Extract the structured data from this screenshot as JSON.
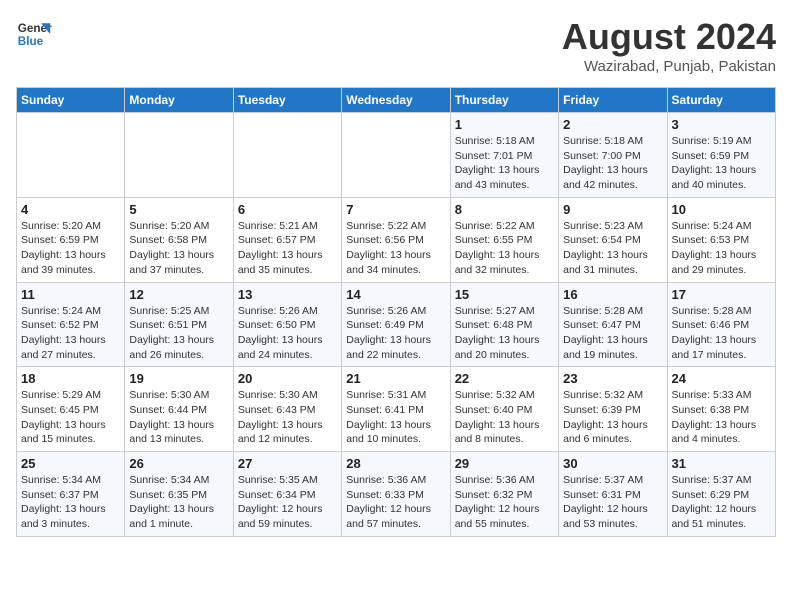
{
  "header": {
    "logo_line1": "General",
    "logo_line2": "Blue",
    "month_year": "August 2024",
    "location": "Wazirabad, Punjab, Pakistan"
  },
  "days_of_week": [
    "Sunday",
    "Monday",
    "Tuesday",
    "Wednesday",
    "Thursday",
    "Friday",
    "Saturday"
  ],
  "weeks": [
    [
      {
        "day": "",
        "info": ""
      },
      {
        "day": "",
        "info": ""
      },
      {
        "day": "",
        "info": ""
      },
      {
        "day": "",
        "info": ""
      },
      {
        "day": "1",
        "info": "Sunrise: 5:18 AM\nSunset: 7:01 PM\nDaylight: 13 hours\nand 43 minutes."
      },
      {
        "day": "2",
        "info": "Sunrise: 5:18 AM\nSunset: 7:00 PM\nDaylight: 13 hours\nand 42 minutes."
      },
      {
        "day": "3",
        "info": "Sunrise: 5:19 AM\nSunset: 6:59 PM\nDaylight: 13 hours\nand 40 minutes."
      }
    ],
    [
      {
        "day": "4",
        "info": "Sunrise: 5:20 AM\nSunset: 6:59 PM\nDaylight: 13 hours\nand 39 minutes."
      },
      {
        "day": "5",
        "info": "Sunrise: 5:20 AM\nSunset: 6:58 PM\nDaylight: 13 hours\nand 37 minutes."
      },
      {
        "day": "6",
        "info": "Sunrise: 5:21 AM\nSunset: 6:57 PM\nDaylight: 13 hours\nand 35 minutes."
      },
      {
        "day": "7",
        "info": "Sunrise: 5:22 AM\nSunset: 6:56 PM\nDaylight: 13 hours\nand 34 minutes."
      },
      {
        "day": "8",
        "info": "Sunrise: 5:22 AM\nSunset: 6:55 PM\nDaylight: 13 hours\nand 32 minutes."
      },
      {
        "day": "9",
        "info": "Sunrise: 5:23 AM\nSunset: 6:54 PM\nDaylight: 13 hours\nand 31 minutes."
      },
      {
        "day": "10",
        "info": "Sunrise: 5:24 AM\nSunset: 6:53 PM\nDaylight: 13 hours\nand 29 minutes."
      }
    ],
    [
      {
        "day": "11",
        "info": "Sunrise: 5:24 AM\nSunset: 6:52 PM\nDaylight: 13 hours\nand 27 minutes."
      },
      {
        "day": "12",
        "info": "Sunrise: 5:25 AM\nSunset: 6:51 PM\nDaylight: 13 hours\nand 26 minutes."
      },
      {
        "day": "13",
        "info": "Sunrise: 5:26 AM\nSunset: 6:50 PM\nDaylight: 13 hours\nand 24 minutes."
      },
      {
        "day": "14",
        "info": "Sunrise: 5:26 AM\nSunset: 6:49 PM\nDaylight: 13 hours\nand 22 minutes."
      },
      {
        "day": "15",
        "info": "Sunrise: 5:27 AM\nSunset: 6:48 PM\nDaylight: 13 hours\nand 20 minutes."
      },
      {
        "day": "16",
        "info": "Sunrise: 5:28 AM\nSunset: 6:47 PM\nDaylight: 13 hours\nand 19 minutes."
      },
      {
        "day": "17",
        "info": "Sunrise: 5:28 AM\nSunset: 6:46 PM\nDaylight: 13 hours\nand 17 minutes."
      }
    ],
    [
      {
        "day": "18",
        "info": "Sunrise: 5:29 AM\nSunset: 6:45 PM\nDaylight: 13 hours\nand 15 minutes."
      },
      {
        "day": "19",
        "info": "Sunrise: 5:30 AM\nSunset: 6:44 PM\nDaylight: 13 hours\nand 13 minutes."
      },
      {
        "day": "20",
        "info": "Sunrise: 5:30 AM\nSunset: 6:43 PM\nDaylight: 13 hours\nand 12 minutes."
      },
      {
        "day": "21",
        "info": "Sunrise: 5:31 AM\nSunset: 6:41 PM\nDaylight: 13 hours\nand 10 minutes."
      },
      {
        "day": "22",
        "info": "Sunrise: 5:32 AM\nSunset: 6:40 PM\nDaylight: 13 hours\nand 8 minutes."
      },
      {
        "day": "23",
        "info": "Sunrise: 5:32 AM\nSunset: 6:39 PM\nDaylight: 13 hours\nand 6 minutes."
      },
      {
        "day": "24",
        "info": "Sunrise: 5:33 AM\nSunset: 6:38 PM\nDaylight: 13 hours\nand 4 minutes."
      }
    ],
    [
      {
        "day": "25",
        "info": "Sunrise: 5:34 AM\nSunset: 6:37 PM\nDaylight: 13 hours\nand 3 minutes."
      },
      {
        "day": "26",
        "info": "Sunrise: 5:34 AM\nSunset: 6:35 PM\nDaylight: 13 hours\nand 1 minute."
      },
      {
        "day": "27",
        "info": "Sunrise: 5:35 AM\nSunset: 6:34 PM\nDaylight: 12 hours\nand 59 minutes."
      },
      {
        "day": "28",
        "info": "Sunrise: 5:36 AM\nSunset: 6:33 PM\nDaylight: 12 hours\nand 57 minutes."
      },
      {
        "day": "29",
        "info": "Sunrise: 5:36 AM\nSunset: 6:32 PM\nDaylight: 12 hours\nand 55 minutes."
      },
      {
        "day": "30",
        "info": "Sunrise: 5:37 AM\nSunset: 6:31 PM\nDaylight: 12 hours\nand 53 minutes."
      },
      {
        "day": "31",
        "info": "Sunrise: 5:37 AM\nSunset: 6:29 PM\nDaylight: 12 hours\nand 51 minutes."
      }
    ]
  ]
}
